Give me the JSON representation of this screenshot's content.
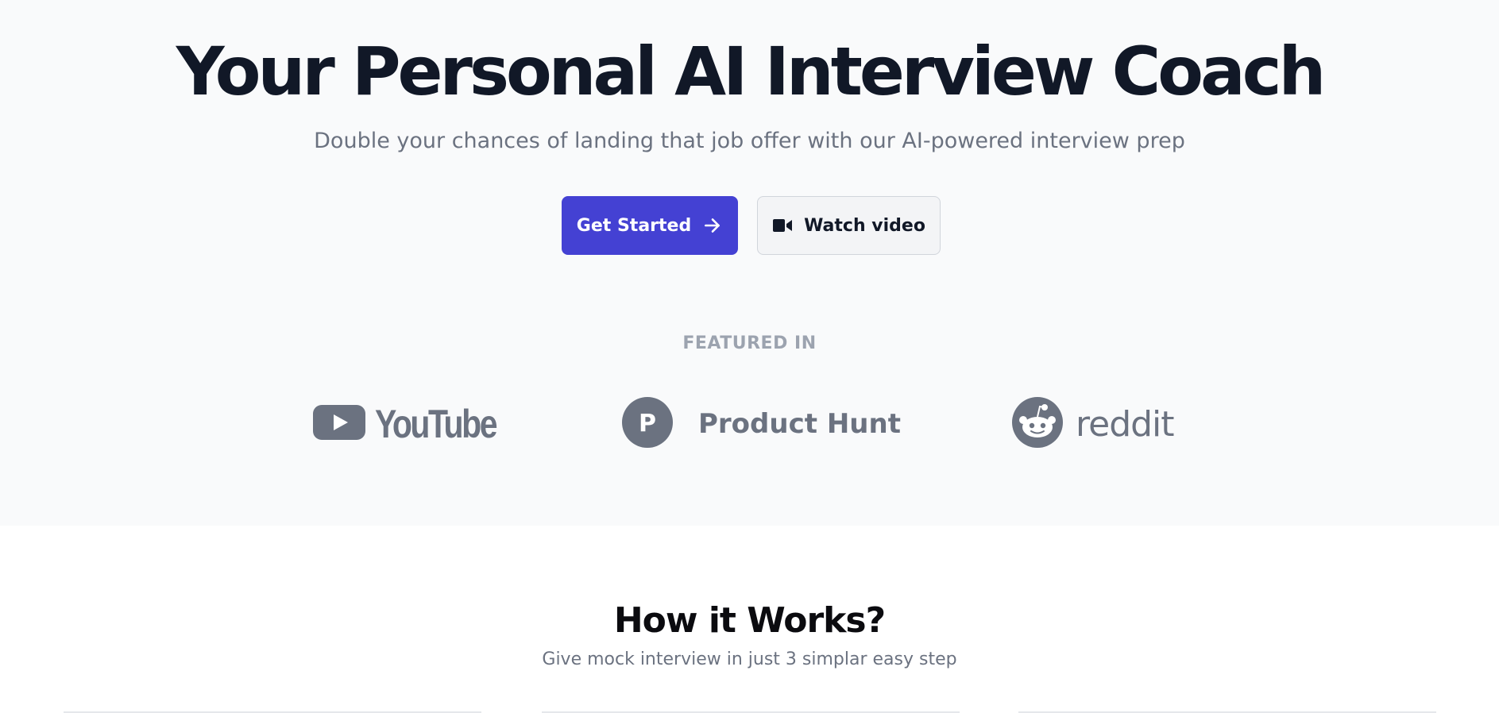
{
  "hero": {
    "title": "Your Personal AI Interview Coach",
    "subtitle": "Double your chances of landing that job offer with our AI-powered interview prep",
    "primary_button": {
      "label": "Get Started",
      "icon": "arrow-right-icon"
    },
    "secondary_button": {
      "label": "Watch video",
      "icon": "video-camera-icon"
    }
  },
  "featured": {
    "label": "FEATURED IN",
    "logos": [
      {
        "name": "YouTube",
        "text": "YouTube",
        "icon": "youtube-icon"
      },
      {
        "name": "Product Hunt",
        "text": "Product Hunt",
        "icon": "product-hunt-icon",
        "badge": "P"
      },
      {
        "name": "reddit",
        "text": "reddit",
        "icon": "reddit-icon"
      }
    ]
  },
  "how_it_works": {
    "title": "How it Works?",
    "subtitle": "Give mock interview in just 3 simplar easy step"
  },
  "colors": {
    "primary": "#4441d3",
    "heading": "#111827",
    "muted": "#6b7280",
    "featured_label": "#9ca3af"
  }
}
